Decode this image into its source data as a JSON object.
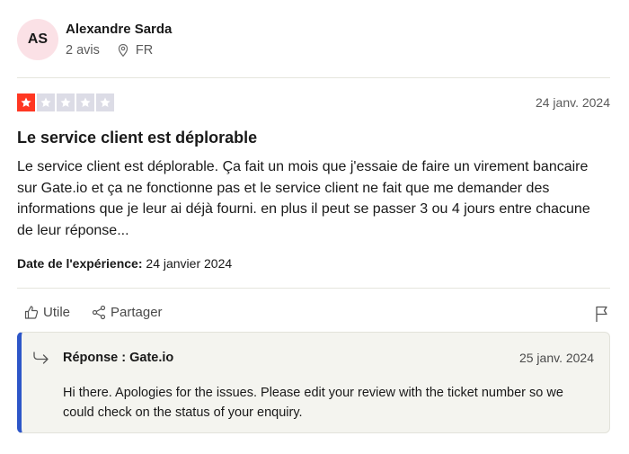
{
  "author": {
    "initials": "AS",
    "name": "Alexandre Sarda",
    "reviews_count": "2 avis",
    "country": "FR"
  },
  "review": {
    "rating": 1,
    "max_rating": 5,
    "rating_color": "#ff3722",
    "empty_star_color": "#dcdce6",
    "date": "24 janv. 2024",
    "title": "Le service client est déplorable",
    "body": "Le service client est déplorable. Ça fait un mois que j'essaie de faire un virement bancaire sur Gate.io et ça ne fonctionne pas et le service client ne fait que me demander des informations que je leur ai déjà fourni. en plus il peut se passer 3 ou 4 jours entre chacune de leur réponse...",
    "experience_label": "Date de l'expérience:",
    "experience_date": "24 janvier 2024"
  },
  "actions": {
    "useful_label": "Utile",
    "share_label": "Partager",
    "useful_icon": "thumbs-up-icon",
    "share_icon": "share-icon",
    "flag_icon": "flag-icon"
  },
  "reply": {
    "title": "Réponse : Gate.io",
    "date": "25 janv. 2024",
    "body": "Hi there. Apologies for the issues. Please edit your review with the ticket number so we could check on the status of your enquiry.",
    "accent_color": "#2d56c8"
  }
}
